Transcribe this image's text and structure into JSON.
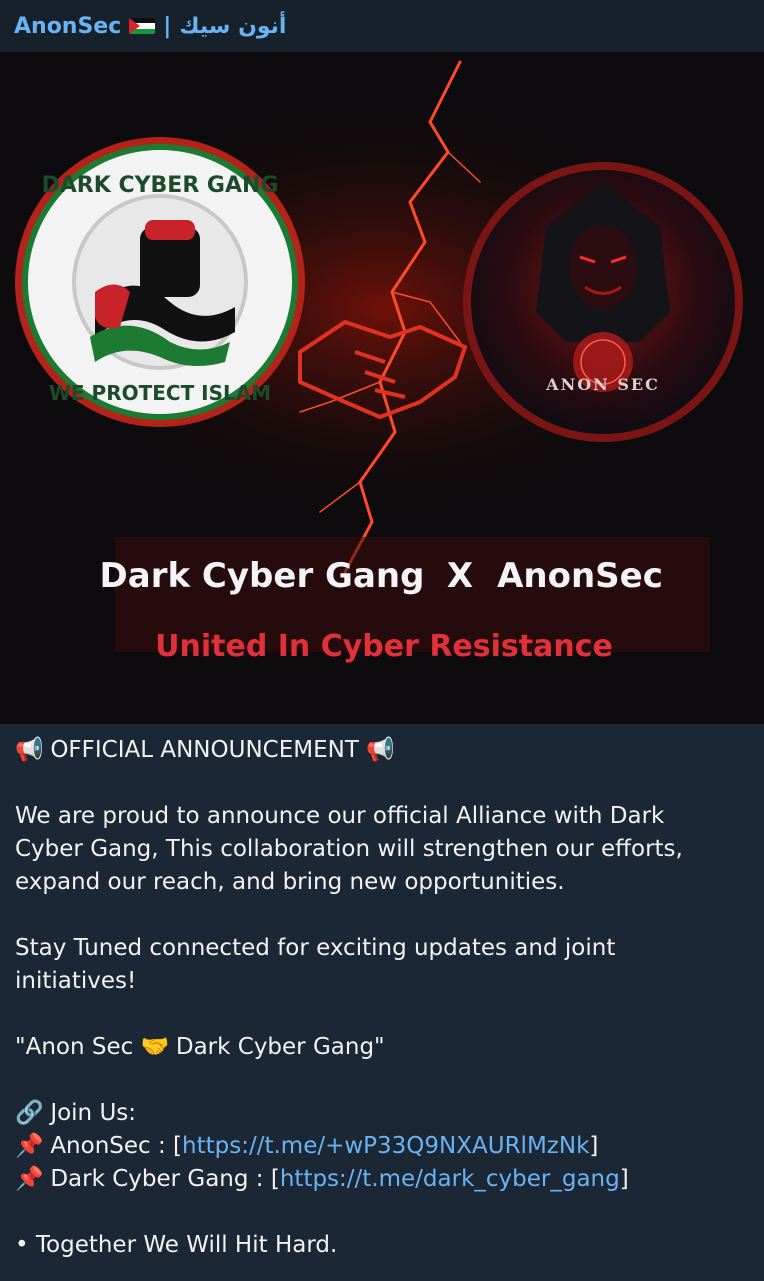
{
  "header": {
    "channel_name": "AnonSec",
    "separator": "|",
    "arabic_name": "أنون سيك"
  },
  "media": {
    "left_logo": {
      "top_text": "DARK CYBER GANG",
      "bottom_text": "WE PROTECT ISLAM"
    },
    "right_logo": {
      "text": "ANON SEC"
    },
    "headline_left": "Dark Cyber Gang",
    "headline_x": "X",
    "headline_right": "AnonSec",
    "subheadline": "United In Cyber Resistance"
  },
  "post": {
    "title": "OFFICIAL ANNOUNCEMENT",
    "para1_line1": "We are proud to announce our official Alliance with Dark",
    "para1_line2": "Cyber Gang, This collaboration will strengthen our efforts,",
    "para1_line3": "expand our reach, and bring new opportunities.",
    "para2_line1": "Stay Tuned connected for exciting updates and joint",
    "para2_line2": "initiatives!",
    "quote_left": "\"Anon Sec",
    "quote_right": "Dark Cyber Gang\"",
    "join_label": "Join Us:",
    "link1_label": "AnonSec : [",
    "link1_url": "https://t.me/+wP33Q9NXAURlMzNk",
    "link1_close": "]",
    "link2_label": "Dark Cyber Gang : [",
    "link2_url": "https://t.me/dark_cyber_gang",
    "link2_close": "]",
    "closing": "• Together We Will Hit Hard."
  },
  "icons": [
    "palestine-flag-icon",
    "megaphone-icon",
    "handshake-icon",
    "link-icon",
    "pushpin-icon"
  ],
  "colors": {
    "background": "#17212b",
    "post_background": "#1b2734",
    "accent": "#6ab3f3",
    "headline_red": "#e0303a"
  }
}
